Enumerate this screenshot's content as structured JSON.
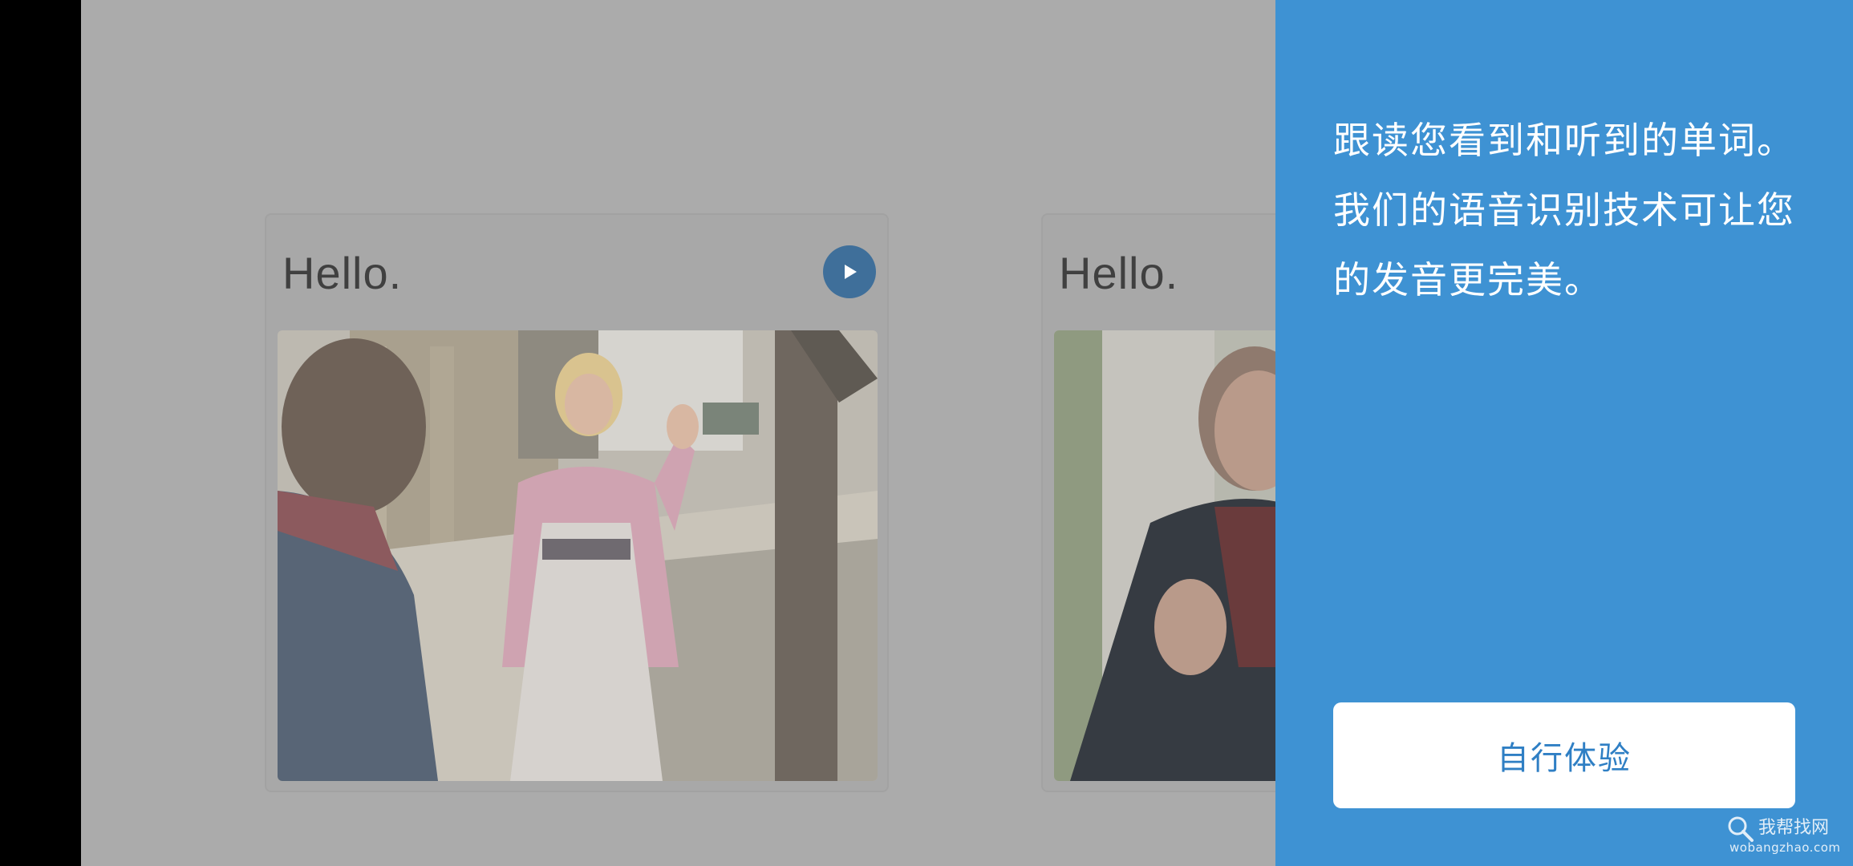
{
  "cards": [
    {
      "title": "Hello."
    },
    {
      "title": "Hello."
    }
  ],
  "panel": {
    "lines": [
      "跟读您看到和听到的单词。",
      "我们的语音识别技术可让您",
      "的发音更完美。"
    ],
    "button_label": "自行体验"
  },
  "watermark": {
    "title": "我帮找网",
    "url": "wobangzhao.com"
  },
  "colors": {
    "panel_bg": "#3e92d3",
    "button_text": "#2f7fc4",
    "play_button": "#3f6f9a",
    "overlay_gray": "#ababab"
  }
}
